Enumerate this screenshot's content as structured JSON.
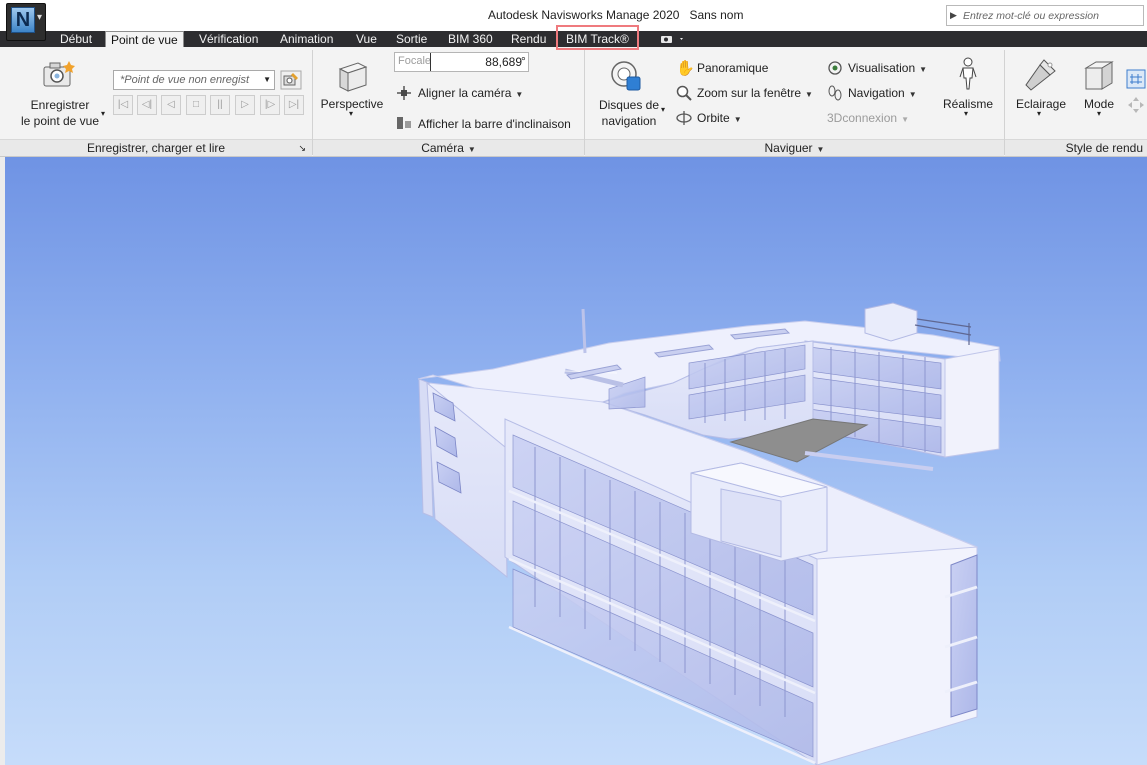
{
  "app": {
    "title": "Autodesk Navisworks Manage 2020",
    "document": "Sans nom",
    "logo_letter": "N"
  },
  "search": {
    "placeholder": "Entrez mot-clé ou expression"
  },
  "tabs": [
    {
      "label": "Début",
      "active": false
    },
    {
      "label": "Point de vue",
      "active": true
    },
    {
      "label": "Vérification",
      "active": false
    },
    {
      "label": "Animation",
      "active": false
    },
    {
      "label": "Vue",
      "active": false
    },
    {
      "label": "Sortie",
      "active": false
    },
    {
      "label": "BIM 360",
      "active": false
    },
    {
      "label": "Rendu",
      "active": false
    },
    {
      "label": "BIM Track®",
      "active": false,
      "highlighted": true
    }
  ],
  "ribbon": {
    "save_panel": {
      "footer": "Enregistrer, charger et lire",
      "save_button": "Enregistrer\nle point de vue",
      "save_line1": "Enregistrer",
      "save_line2": "le point de vue",
      "viewpoint_combo": "*Point de vue non enregist"
    },
    "camera_panel": {
      "footer": "Caméra",
      "focal_label": "Focale",
      "focal_value": "88,689",
      "focal_unit": "°",
      "perspective": "Perspective",
      "align_camera": "Aligner la caméra",
      "tilt_bar": "Afficher la barre d'inclinaison"
    },
    "navigate_panel": {
      "footer": "Naviguer",
      "nav_wheels_line1": "Disques de",
      "nav_wheels_line2": "navigation",
      "pan": "Panoramique",
      "zoom_window": "Zoom sur la fenêtre",
      "orbit": "Orbite",
      "look_around": "Visualisation",
      "navigation": "Navigation",
      "connexion": "3Dconnexion",
      "realism": "Réalisme"
    },
    "render_panel": {
      "footer": "Style de rendu",
      "lighting": "Eclairage",
      "mode": "Mode"
    }
  },
  "colors": {
    "tabbar_bg": "#2d2d30",
    "ribbon_bg": "#f3f3f3",
    "highlight_border": "#ef7a7e",
    "sky_top": "#6f93e4",
    "sky_bottom": "#c6dcfa"
  }
}
